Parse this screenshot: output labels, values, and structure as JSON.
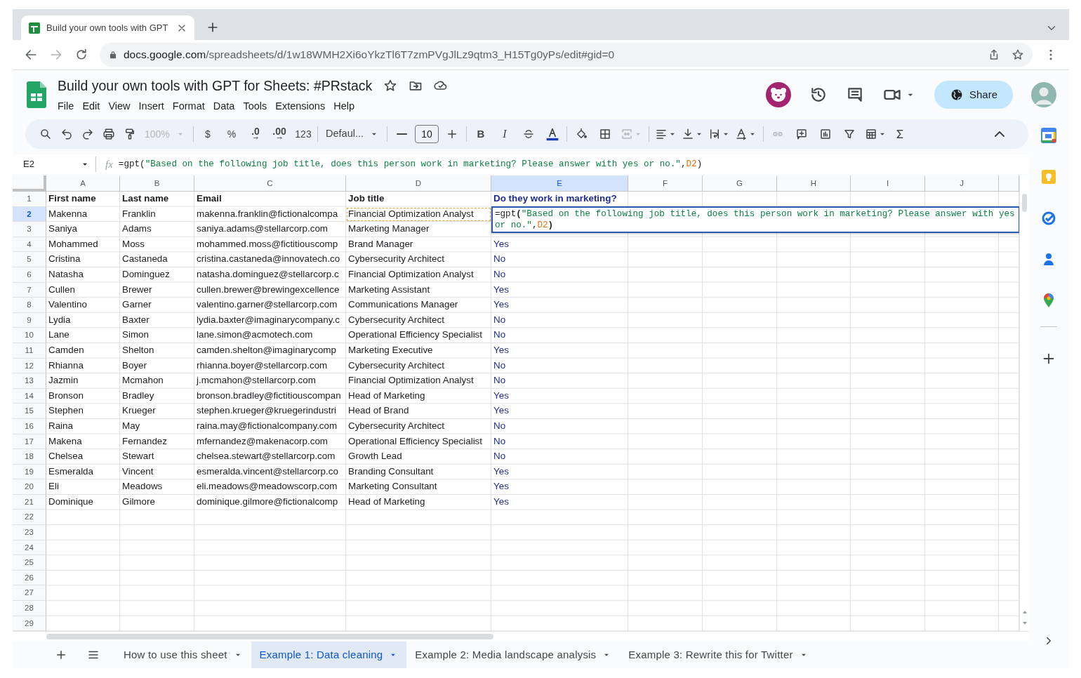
{
  "browser": {
    "tab_title": "Build your own tools with GPT",
    "url_host": "docs.google.com",
    "url_path": "/spreadsheets/d/1w18WMH2Xi6oYkzTl6T7zmPVgJlLz9qtm3_H15Tg0yPs/edit#gid=0"
  },
  "document": {
    "title": "Build your own tools with GPT for Sheets: #PRstack",
    "starred": false,
    "menu": [
      "File",
      "Edit",
      "View",
      "Insert",
      "Format",
      "Data",
      "Tools",
      "Extensions",
      "Help"
    ],
    "share_label": "Share"
  },
  "toolbar": {
    "zoom": {
      "text": "100%",
      "disabled": true
    },
    "currency": "$",
    "percent": "%",
    "decrease_decimals": ".0",
    "increase_decimals": ".00",
    "number_format": "123",
    "font": "Defaul...",
    "font_size": "10",
    "bold": "B",
    "italic": "I",
    "merge_disabled": true,
    "link_disabled": true
  },
  "formula_bar": {
    "cell_ref": "E2",
    "function_label": "fx",
    "formula": [
      {
        "kind": "func",
        "text": "=gpt"
      },
      {
        "kind": "paren",
        "text": "("
      },
      {
        "kind": "string",
        "text": "\"Based on the following job title, does this person work in marketing? Please answer with yes or no.\""
      },
      {
        "kind": "punct",
        "text": ","
      },
      {
        "kind": "ref",
        "text": "D2"
      },
      {
        "kind": "paren",
        "text": ")"
      }
    ]
  },
  "grid": {
    "columns": [
      {
        "label": "A",
        "selected": false
      },
      {
        "label": "B",
        "selected": false
      },
      {
        "label": "C",
        "selected": false
      },
      {
        "label": "D",
        "selected": false
      },
      {
        "label": "E",
        "selected": true
      },
      {
        "label": "F",
        "selected": false
      },
      {
        "label": "G",
        "selected": false
      },
      {
        "label": "H",
        "selected": false
      },
      {
        "label": "I",
        "selected": false
      },
      {
        "label": "J",
        "selected": false
      }
    ],
    "rows": [
      {
        "number": "1",
        "selected": false,
        "kind": "header",
        "cells": [
          "First name",
          "Last name",
          "Email",
          "Job title",
          "Do they work in marketing?"
        ]
      },
      {
        "number": "2",
        "selected": true,
        "kind": "data",
        "cells": [
          {
            "text": "Makenna",
            "referenced": false
          },
          {
            "text": "Franklin",
            "referenced": false
          },
          {
            "text": "makenna.franklin@fictionalcompa",
            "referenced": false
          },
          {
            "text": "Financial Optimization Analyst",
            "referenced": true
          }
        ]
      },
      {
        "number": "3",
        "selected": false,
        "kind": "data",
        "cells": [
          "Saniya",
          "Adams",
          "saniya.adams@stellarcorp.com",
          "Marketing Manager"
        ]
      },
      {
        "number": "4",
        "selected": false,
        "kind": "data",
        "cells": [
          "Mohammed",
          "Moss",
          "mohammed.moss@fictitiouscomp",
          "Brand Manager",
          "Yes"
        ]
      },
      {
        "number": "5",
        "selected": false,
        "kind": "data",
        "cells": [
          "Cristina",
          "Castaneda",
          "cristina.castaneda@innovatech.co",
          "Cybersecurity Architect",
          "No"
        ]
      },
      {
        "number": "6",
        "selected": false,
        "kind": "data",
        "cells": [
          "Natasha",
          "Dominguez",
          "natasha.dominguez@stellarcorp.c",
          "Financial Optimization Analyst",
          "No"
        ]
      },
      {
        "number": "7",
        "selected": false,
        "kind": "data",
        "cells": [
          "Cullen",
          "Brewer",
          "cullen.brewer@brewingexcellence",
          "Marketing Assistant",
          "Yes"
        ]
      },
      {
        "number": "8",
        "selected": false,
        "kind": "data",
        "cells": [
          "Valentino",
          "Garner",
          "valentino.garner@stellarcorp.com",
          "Communications Manager",
          "Yes"
        ]
      },
      {
        "number": "9",
        "selected": false,
        "kind": "data",
        "cells": [
          "Lydia",
          "Baxter",
          "lydia.baxter@imaginarycompany.c",
          "Cybersecurity Architect",
          "No"
        ]
      },
      {
        "number": "10",
        "selected": false,
        "kind": "data",
        "cells": [
          "Lane",
          "Simon",
          "lane.simon@acmotech.com",
          "Operational Efficiency Specialist",
          "No"
        ]
      },
      {
        "number": "11",
        "selected": false,
        "kind": "data",
        "cells": [
          "Camden",
          "Shelton",
          "camden.shelton@imaginarycomp",
          "Marketing Executive",
          "Yes"
        ]
      },
      {
        "number": "12",
        "selected": false,
        "kind": "data",
        "cells": [
          "Rhianna",
          "Boyer",
          "rhianna.boyer@stellarcorp.com",
          "Cybersecurity Architect",
          "No"
        ]
      },
      {
        "number": "13",
        "selected": false,
        "kind": "data",
        "cells": [
          "Jazmin",
          "Mcmahon",
          "j.mcmahon@stellarcorp.com",
          "Financial Optimization Analyst",
          "No"
        ]
      },
      {
        "number": "14",
        "selected": false,
        "kind": "data",
        "cells": [
          "Bronson",
          "Bradley",
          "bronson.bradley@fictitiouscompan",
          "Head of Marketing",
          "Yes"
        ]
      },
      {
        "number": "15",
        "selected": false,
        "kind": "data",
        "cells": [
          "Stephen",
          "Krueger",
          "stephen.krueger@kruegerindustri",
          "Head of Brand",
          "Yes"
        ]
      },
      {
        "number": "16",
        "selected": false,
        "kind": "data",
        "cells": [
          "Raina",
          "May",
          "raina.may@fictionalcompany.com",
          "Cybersecurity Architect",
          "No"
        ]
      },
      {
        "number": "17",
        "selected": false,
        "kind": "data",
        "cells": [
          "Makena",
          "Fernandez",
          "mfernandez@makenacorp.com",
          "Operational Efficiency Specialist",
          "No"
        ]
      },
      {
        "number": "18",
        "selected": false,
        "kind": "data",
        "cells": [
          "Chelsea",
          "Stewart",
          "chelsea.stewart@stellarcorp.com",
          "Growth Lead",
          "No"
        ]
      },
      {
        "number": "19",
        "selected": false,
        "kind": "data",
        "cells": [
          "Esmeralda",
          "Vincent",
          "esmeralda.vincent@stellarcorp.co",
          "Branding Consultant",
          "Yes"
        ]
      },
      {
        "number": "20",
        "selected": false,
        "kind": "data",
        "cells": [
          "Eli",
          "Meadows",
          "eli.meadows@meadowscorp.com",
          "Marketing Consultant",
          "Yes"
        ]
      },
      {
        "number": "21",
        "selected": false,
        "kind": "data",
        "cells": [
          "Dominique",
          "Gilmore",
          "dominique.gilmore@fictionalcomp",
          "Head of Marketing",
          "Yes"
        ]
      },
      {
        "number": "22",
        "selected": false,
        "kind": "data"
      },
      {
        "number": "23",
        "selected": false,
        "kind": "data"
      },
      {
        "number": "24",
        "selected": false,
        "kind": "data"
      },
      {
        "number": "25",
        "selected": false,
        "kind": "data"
      },
      {
        "number": "26",
        "selected": false,
        "kind": "data"
      },
      {
        "number": "27",
        "selected": false,
        "kind": "data"
      },
      {
        "number": "28",
        "selected": false,
        "kind": "data"
      },
      {
        "number": "29",
        "selected": false,
        "kind": "data"
      }
    ],
    "editor": {
      "formula": [
        {
          "kind": "func",
          "text": "=gpt"
        },
        {
          "kind": "paren",
          "text": "("
        },
        {
          "kind": "string",
          "text": "\"Based on the following job title, does this person work in marketing? Please answer with yes or no.\""
        },
        {
          "kind": "punct",
          "text": ","
        },
        {
          "kind": "ref",
          "text": "D2"
        },
        {
          "kind": "paren",
          "text": ")"
        }
      ]
    }
  },
  "sheet_tabs": [
    {
      "label": "How to use this sheet",
      "selected": false
    },
    {
      "label": "Example 1: Data cleaning",
      "selected": true
    },
    {
      "label": "Example 2: Media landscape analysis",
      "selected": false
    },
    {
      "label": "Example 3: Rewrite this for Twitter",
      "selected": false
    }
  ]
}
